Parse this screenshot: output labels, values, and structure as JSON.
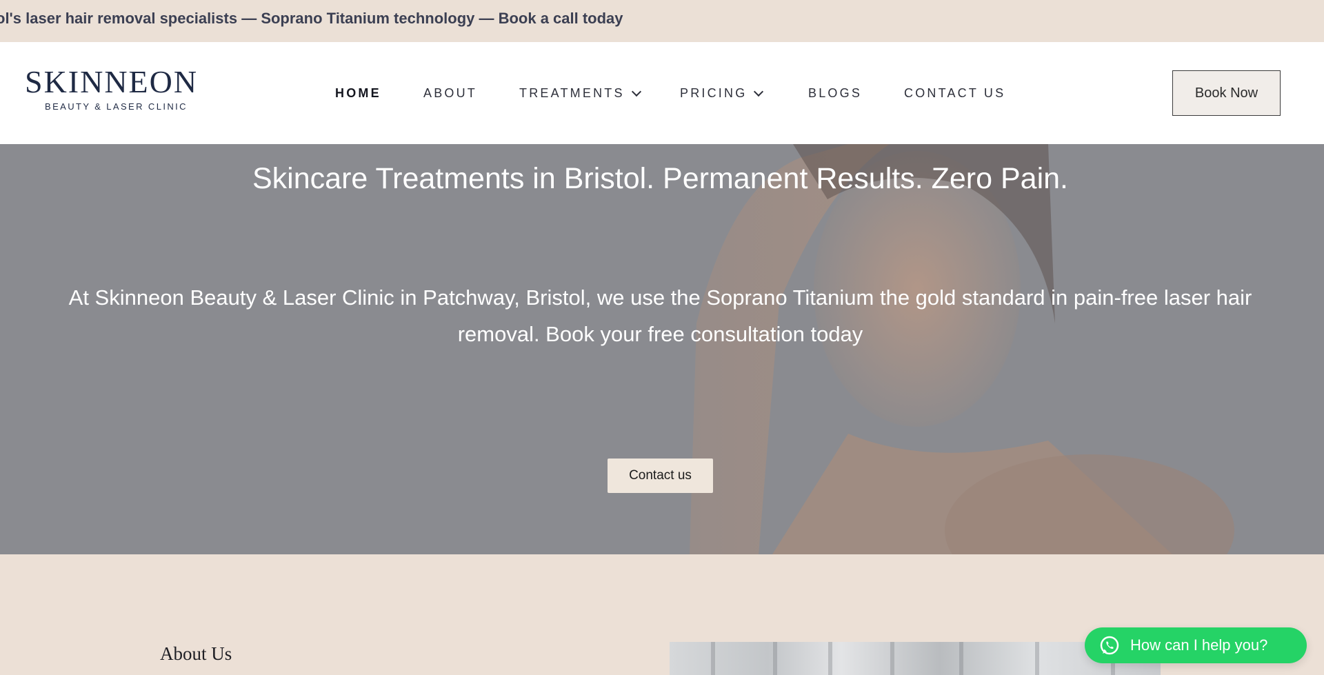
{
  "announcement": {
    "text": "ol's laser hair removal specialists — Soprano Titanium technology — Book a call today"
  },
  "header": {
    "logo": {
      "name": "SKINNEON",
      "tagline": "BEAUTY & LASER CLINIC"
    },
    "nav": [
      {
        "label": "HOME",
        "active": true,
        "has_dropdown": false
      },
      {
        "label": "ABOUT",
        "active": false,
        "has_dropdown": false
      },
      {
        "label": "TREATMENTS",
        "active": false,
        "has_dropdown": true
      },
      {
        "label": "PRICING",
        "active": false,
        "has_dropdown": true
      },
      {
        "label": "BLOGS",
        "active": false,
        "has_dropdown": false
      },
      {
        "label": "CONTACT US",
        "active": false,
        "has_dropdown": false
      }
    ],
    "book_button": "Book Now"
  },
  "hero": {
    "title": "Skincare Treatments in Bristol. Permanent Results. Zero Pain.",
    "subtitle": "At Skinneon Beauty & Laser Clinic in Patchway, Bristol, we use the Soprano Titanium the gold standard in pain-free laser hair removal. Book your free consultation today",
    "cta": "Contact us"
  },
  "about": {
    "title": "About Us"
  },
  "chat_widget": {
    "label": "How can I help you?",
    "icon": "whatsapp-icon"
  },
  "colors": {
    "announcement_bg": "#ebe0d6",
    "section_bg": "#ece0d6",
    "brand_navy": "#1f2a44",
    "chat_green": "#25d366",
    "hero_overlay": "#8a8b90"
  }
}
